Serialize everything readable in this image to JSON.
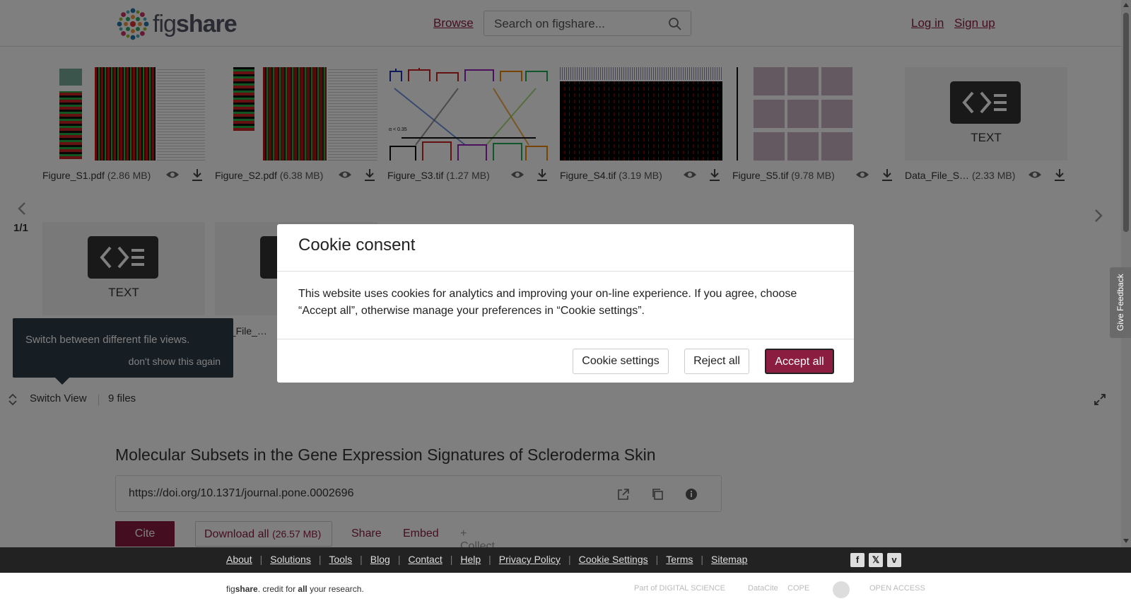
{
  "header": {
    "logo_text_light": "fig",
    "logo_text_bold": "share",
    "browse_label": "Browse",
    "search_placeholder": "Search on figshare...",
    "login_label": "Log in",
    "signup_label": "Sign up"
  },
  "files": [
    {
      "name": "Figure_S1.pdf",
      "size": "(2.86 MB)",
      "kind": "pdf-heatmap"
    },
    {
      "name": "Figure_S2.pdf",
      "size": "(6.38 MB)",
      "kind": "pdf-heatmap"
    },
    {
      "name": "Figure_S3.tif",
      "size": "(1.27 MB)",
      "kind": "dendrogram"
    },
    {
      "name": "Figure_S4.tif",
      "size": "(3.19 MB)",
      "kind": "heatmap-dark"
    },
    {
      "name": "Figure_S5.tif",
      "size": "(9.78 MB)",
      "kind": "histology"
    },
    {
      "name": "Data_File_S…",
      "size": "(2.33 MB)",
      "kind": "text"
    }
  ],
  "second_row": [
    {
      "label": "TEXT",
      "name": ""
    },
    {
      "label": "",
      "name": "a_File_…"
    }
  ],
  "text_file_label": "TEXT",
  "page_indicator": "1/1",
  "tooltip": {
    "text": "Switch between different file views.",
    "dismiss": "don't show this again"
  },
  "switch_bar": {
    "label": "Switch View",
    "count": "9 files"
  },
  "article": {
    "title": "Molecular Subsets in the Gene Expression Signatures of Scleroderma Skin",
    "doi": "https://doi.org/10.1371/journal.pone.0002696"
  },
  "actions": {
    "cite": "Cite",
    "download_all": "Download all",
    "download_size": "(26.57 MB)",
    "share": "Share",
    "embed": "Embed",
    "collect": "+ Collect"
  },
  "cookie_modal": {
    "title": "Cookie consent",
    "body": "This website uses cookies for analytics and improving your on-line experience. If you agree, choose “Accept all”, otherwise manage your preferences in “Cookie settings”.",
    "settings_btn": "Cookie settings",
    "reject_btn": "Reject all",
    "accept_btn": "Accept all"
  },
  "feedback_label": "Give Feedback",
  "footer": {
    "links": [
      "About",
      "Solutions",
      "Tools",
      "Blog",
      "Contact",
      "Help",
      "Privacy Policy",
      "Cookie Settings",
      "Terms",
      "Sitemap"
    ],
    "tagline_prefix": "fig",
    "tagline_bold": "share",
    "tagline_mid": ". credit for ",
    "tagline_all": "all",
    "tagline_end": " your research.",
    "partner_ds": "Part of DIGITAL SCIENCE",
    "partner_datacite": "DataCite",
    "partner_cope": "COPE",
    "partner_oa": "OPEN ACCESS"
  },
  "colors": {
    "brand": "#8b1d41",
    "footer_bg": "#222222",
    "tooltip_bg": "#2c3b47"
  }
}
